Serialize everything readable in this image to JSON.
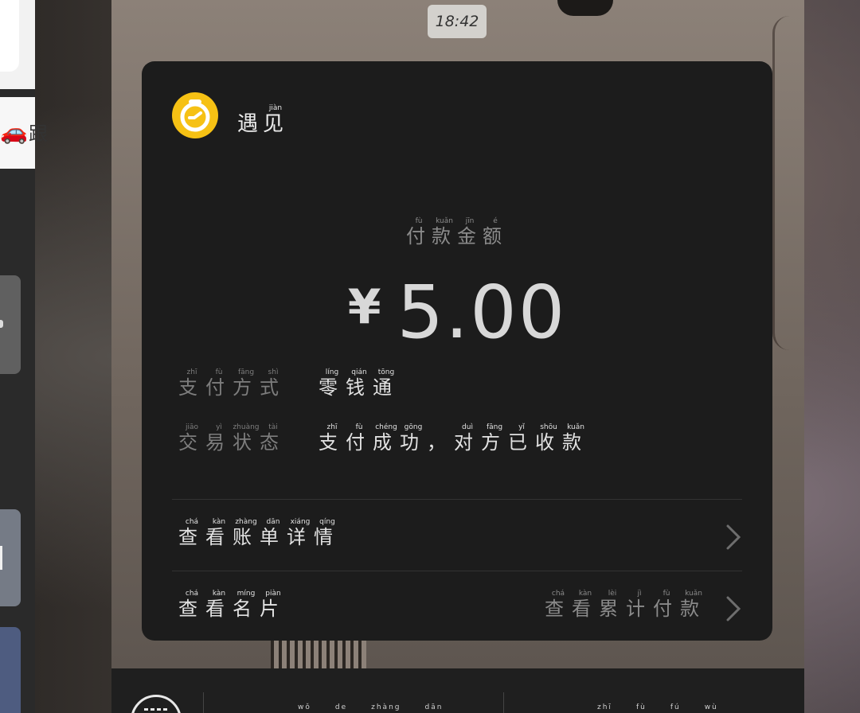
{
  "status_time": "18:42",
  "left_strip": {
    "partial_text": "跟"
  },
  "card": {
    "app_name": [
      {
        "char": "遇",
        "py": ""
      },
      {
        "char": "见",
        "py": "jiàn"
      }
    ],
    "amount_label": [
      {
        "char": "付",
        "py": "fù"
      },
      {
        "char": "款",
        "py": "kuǎn"
      },
      {
        "char": "金",
        "py": "jīn"
      },
      {
        "char": "额",
        "py": "é"
      }
    ],
    "currency_symbol": "¥",
    "amount": "5.00",
    "payment_method_label": [
      {
        "char": "支",
        "py": "zhī"
      },
      {
        "char": "付",
        "py": "fù"
      },
      {
        "char": "方",
        "py": "fāng"
      },
      {
        "char": "式",
        "py": "shì"
      }
    ],
    "payment_method_value": [
      {
        "char": "零",
        "py": "líng"
      },
      {
        "char": "钱",
        "py": "qián"
      },
      {
        "char": "通",
        "py": "tōng"
      }
    ],
    "status_label": [
      {
        "char": "交",
        "py": "jiāo"
      },
      {
        "char": "易",
        "py": "yì"
      },
      {
        "char": "状",
        "py": "zhuàng"
      },
      {
        "char": "态",
        "py": "tài"
      }
    ],
    "status_value": [
      {
        "char": "支",
        "py": "zhī"
      },
      {
        "char": "付",
        "py": "fù"
      },
      {
        "char": "成",
        "py": "chéng"
      },
      {
        "char": "功",
        "py": "gōng"
      },
      {
        "char": "，",
        "py": ""
      },
      {
        "char": "对",
        "py": "duì"
      },
      {
        "char": "方",
        "py": "fāng"
      },
      {
        "char": "已",
        "py": "yǐ"
      },
      {
        "char": "收",
        "py": "shōu"
      },
      {
        "char": "款",
        "py": "kuǎn"
      }
    ],
    "bill_details_link": [
      {
        "char": "查",
        "py": "chá"
      },
      {
        "char": "看",
        "py": "kàn"
      },
      {
        "char": "账",
        "py": "zhàng"
      },
      {
        "char": "单",
        "py": "dān"
      },
      {
        "char": "详",
        "py": "xiáng"
      },
      {
        "char": "情",
        "py": "qíng"
      }
    ],
    "business_card_link": [
      {
        "char": "查",
        "py": "chá"
      },
      {
        "char": "看",
        "py": "kàn"
      },
      {
        "char": "名",
        "py": "míng"
      },
      {
        "char": "片",
        "py": "piàn"
      }
    ],
    "cumulative_link": [
      {
        "char": "查",
        "py": "chá"
      },
      {
        "char": "看",
        "py": "kàn"
      },
      {
        "char": "累",
        "py": "lèi"
      },
      {
        "char": "计",
        "py": "jì"
      },
      {
        "char": "付",
        "py": "fù"
      },
      {
        "char": "款",
        "py": "kuǎn"
      }
    ]
  },
  "bottom_bar": {
    "left_pinyin": [
      "wǒ",
      "de",
      "zhàng",
      "dān"
    ],
    "right_pinyin": [
      "zhī",
      "fù",
      "fú",
      "wù"
    ]
  },
  "colors": {
    "card_bg": "#1c1c1c",
    "logo_yellow": "#f6c114",
    "primary_text": "#e2e2e2",
    "secondary_text": "#7d7d7d"
  }
}
